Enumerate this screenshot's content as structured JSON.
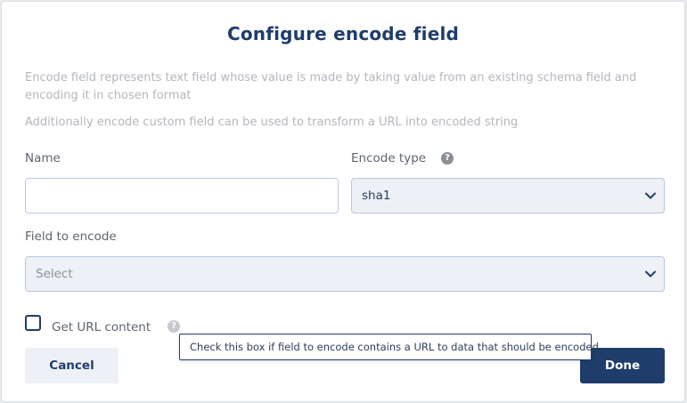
{
  "dialog": {
    "title": "Configure encode field",
    "description_1": "Encode field represents text field whose value is made by taking value from an existing schema field and encoding it in chosen format",
    "description_2": "Additionally encode custom field can be used to transform a URL into encoded string"
  },
  "form": {
    "name": {
      "label": "Name",
      "value": ""
    },
    "encode_type": {
      "label": "Encode type",
      "selected": "sha1",
      "help_icon": "question-circle-icon"
    },
    "field_to_encode": {
      "label": "Field to encode",
      "selected": "Select"
    },
    "get_url_content": {
      "label": "Get URL content",
      "checked": false,
      "help_icon": "question-circle-icon",
      "tooltip": "Check this box if field to encode contains a URL to data that should be encoded"
    }
  },
  "buttons": {
    "cancel": "Cancel",
    "done": "Done"
  },
  "colors": {
    "primary": "#1f3d6b",
    "muted_text": "#b3b7bd",
    "select_bg": "#edf0f4",
    "input_border": "#b9c7e6"
  }
}
